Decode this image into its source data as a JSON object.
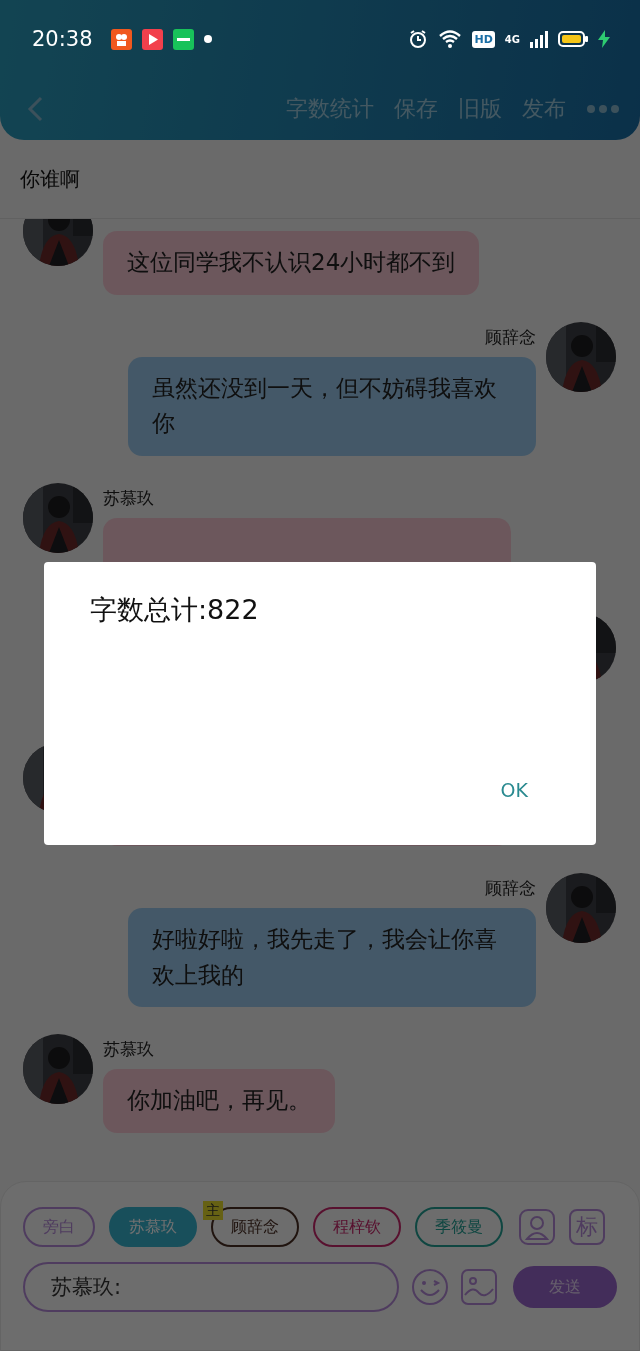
{
  "status_bar": {
    "time": "20:38",
    "hd": "HD",
    "network": "4G"
  },
  "header": {
    "actions": [
      "字数统计",
      "保存",
      "旧版",
      "发布"
    ]
  },
  "title": "你谁啊",
  "messages": [
    {
      "kind": "incoming",
      "text": "这位同学我不认识24小时都不到"
    },
    {
      "kind": "outgoing",
      "name": "顾辞念",
      "text": "虽然还没到一天，但不妨碍我喜欢你"
    },
    {
      "kind": "incoming",
      "name": "苏慕玖"
    },
    {
      "kind": "outgoing"
    },
    {
      "kind": "incoming"
    },
    {
      "kind": "outgoing",
      "name": "顾辞念",
      "text": "好啦好啦，我先走了，我会让你喜欢上我的"
    },
    {
      "kind": "incoming",
      "name": "苏慕玖",
      "text": "你加油吧，再见。"
    }
  ],
  "roles": [
    {
      "label": "旁白",
      "selected": false
    },
    {
      "label": "苏慕玖",
      "selected": true
    },
    {
      "label": "顾辞念",
      "selected": false,
      "badge": "主"
    },
    {
      "label": "程梓钦",
      "selected": false
    },
    {
      "label": "季筱曼",
      "selected": false
    }
  ],
  "tag_button": "标",
  "input": {
    "value": "苏慕玖:"
  },
  "send": "发送",
  "dialog": {
    "message": "字数总计:822",
    "button": "OK"
  }
}
